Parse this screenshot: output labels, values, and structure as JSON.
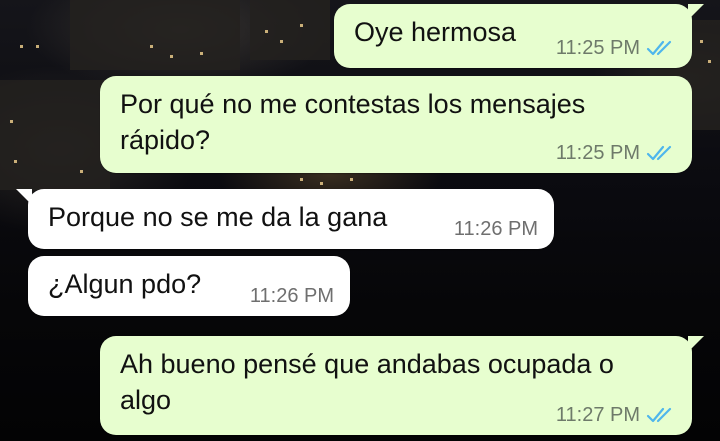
{
  "theme": {
    "outgoing_bubble_color": "#e7fecf",
    "incoming_bubble_color": "#ffffff",
    "read_tick_color": "#4fb6ec"
  },
  "messages": [
    {
      "direction": "outgoing",
      "text": "Oye hermosa",
      "time": "11:25 PM",
      "status_icon": "double-check-read-icon"
    },
    {
      "direction": "outgoing",
      "text": "Por qué no me contestas los mensajes\nrápido?",
      "time": "11:25 PM",
      "status_icon": "double-check-read-icon"
    },
    {
      "direction": "incoming",
      "text": "Porque no se me da la gana",
      "time": "11:26 PM"
    },
    {
      "direction": "incoming",
      "text": "¿Algun pdo?",
      "time": "11:26 PM"
    },
    {
      "direction": "outgoing",
      "text": "Ah bueno pensé que andabas ocupada o\nalgo",
      "time": "11:27 PM",
      "status_icon": "double-check-read-icon"
    }
  ]
}
